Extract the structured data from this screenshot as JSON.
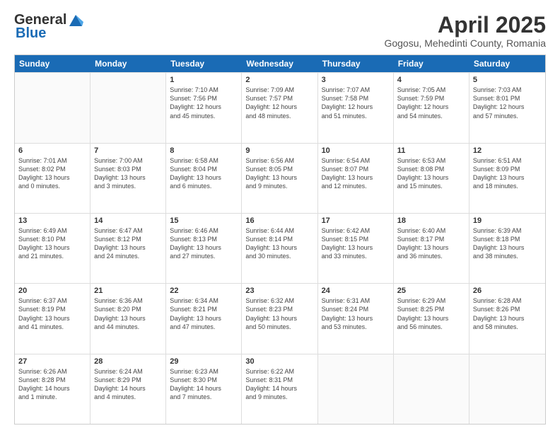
{
  "header": {
    "logo_general": "General",
    "logo_blue": "Blue",
    "month_title": "April 2025",
    "subtitle": "Gogosu, Mehedinti County, Romania"
  },
  "calendar": {
    "days": [
      "Sunday",
      "Monday",
      "Tuesday",
      "Wednesday",
      "Thursday",
      "Friday",
      "Saturday"
    ],
    "rows": [
      [
        {
          "day": "",
          "empty": true
        },
        {
          "day": "",
          "empty": true
        },
        {
          "day": "1",
          "line1": "Sunrise: 7:10 AM",
          "line2": "Sunset: 7:56 PM",
          "line3": "Daylight: 12 hours",
          "line4": "and 45 minutes."
        },
        {
          "day": "2",
          "line1": "Sunrise: 7:09 AM",
          "line2": "Sunset: 7:57 PM",
          "line3": "Daylight: 12 hours",
          "line4": "and 48 minutes."
        },
        {
          "day": "3",
          "line1": "Sunrise: 7:07 AM",
          "line2": "Sunset: 7:58 PM",
          "line3": "Daylight: 12 hours",
          "line4": "and 51 minutes."
        },
        {
          "day": "4",
          "line1": "Sunrise: 7:05 AM",
          "line2": "Sunset: 7:59 PM",
          "line3": "Daylight: 12 hours",
          "line4": "and 54 minutes."
        },
        {
          "day": "5",
          "line1": "Sunrise: 7:03 AM",
          "line2": "Sunset: 8:01 PM",
          "line3": "Daylight: 12 hours",
          "line4": "and 57 minutes."
        }
      ],
      [
        {
          "day": "6",
          "line1": "Sunrise: 7:01 AM",
          "line2": "Sunset: 8:02 PM",
          "line3": "Daylight: 13 hours",
          "line4": "and 0 minutes."
        },
        {
          "day": "7",
          "line1": "Sunrise: 7:00 AM",
          "line2": "Sunset: 8:03 PM",
          "line3": "Daylight: 13 hours",
          "line4": "and 3 minutes."
        },
        {
          "day": "8",
          "line1": "Sunrise: 6:58 AM",
          "line2": "Sunset: 8:04 PM",
          "line3": "Daylight: 13 hours",
          "line4": "and 6 minutes."
        },
        {
          "day": "9",
          "line1": "Sunrise: 6:56 AM",
          "line2": "Sunset: 8:05 PM",
          "line3": "Daylight: 13 hours",
          "line4": "and 9 minutes."
        },
        {
          "day": "10",
          "line1": "Sunrise: 6:54 AM",
          "line2": "Sunset: 8:07 PM",
          "line3": "Daylight: 13 hours",
          "line4": "and 12 minutes."
        },
        {
          "day": "11",
          "line1": "Sunrise: 6:53 AM",
          "line2": "Sunset: 8:08 PM",
          "line3": "Daylight: 13 hours",
          "line4": "and 15 minutes."
        },
        {
          "day": "12",
          "line1": "Sunrise: 6:51 AM",
          "line2": "Sunset: 8:09 PM",
          "line3": "Daylight: 13 hours",
          "line4": "and 18 minutes."
        }
      ],
      [
        {
          "day": "13",
          "line1": "Sunrise: 6:49 AM",
          "line2": "Sunset: 8:10 PM",
          "line3": "Daylight: 13 hours",
          "line4": "and 21 minutes."
        },
        {
          "day": "14",
          "line1": "Sunrise: 6:47 AM",
          "line2": "Sunset: 8:12 PM",
          "line3": "Daylight: 13 hours",
          "line4": "and 24 minutes."
        },
        {
          "day": "15",
          "line1": "Sunrise: 6:46 AM",
          "line2": "Sunset: 8:13 PM",
          "line3": "Daylight: 13 hours",
          "line4": "and 27 minutes."
        },
        {
          "day": "16",
          "line1": "Sunrise: 6:44 AM",
          "line2": "Sunset: 8:14 PM",
          "line3": "Daylight: 13 hours",
          "line4": "and 30 minutes."
        },
        {
          "day": "17",
          "line1": "Sunrise: 6:42 AM",
          "line2": "Sunset: 8:15 PM",
          "line3": "Daylight: 13 hours",
          "line4": "and 33 minutes."
        },
        {
          "day": "18",
          "line1": "Sunrise: 6:40 AM",
          "line2": "Sunset: 8:17 PM",
          "line3": "Daylight: 13 hours",
          "line4": "and 36 minutes."
        },
        {
          "day": "19",
          "line1": "Sunrise: 6:39 AM",
          "line2": "Sunset: 8:18 PM",
          "line3": "Daylight: 13 hours",
          "line4": "and 38 minutes."
        }
      ],
      [
        {
          "day": "20",
          "line1": "Sunrise: 6:37 AM",
          "line2": "Sunset: 8:19 PM",
          "line3": "Daylight: 13 hours",
          "line4": "and 41 minutes."
        },
        {
          "day": "21",
          "line1": "Sunrise: 6:36 AM",
          "line2": "Sunset: 8:20 PM",
          "line3": "Daylight: 13 hours",
          "line4": "and 44 minutes."
        },
        {
          "day": "22",
          "line1": "Sunrise: 6:34 AM",
          "line2": "Sunset: 8:21 PM",
          "line3": "Daylight: 13 hours",
          "line4": "and 47 minutes."
        },
        {
          "day": "23",
          "line1": "Sunrise: 6:32 AM",
          "line2": "Sunset: 8:23 PM",
          "line3": "Daylight: 13 hours",
          "line4": "and 50 minutes."
        },
        {
          "day": "24",
          "line1": "Sunrise: 6:31 AM",
          "line2": "Sunset: 8:24 PM",
          "line3": "Daylight: 13 hours",
          "line4": "and 53 minutes."
        },
        {
          "day": "25",
          "line1": "Sunrise: 6:29 AM",
          "line2": "Sunset: 8:25 PM",
          "line3": "Daylight: 13 hours",
          "line4": "and 56 minutes."
        },
        {
          "day": "26",
          "line1": "Sunrise: 6:28 AM",
          "line2": "Sunset: 8:26 PM",
          "line3": "Daylight: 13 hours",
          "line4": "and 58 minutes."
        }
      ],
      [
        {
          "day": "27",
          "line1": "Sunrise: 6:26 AM",
          "line2": "Sunset: 8:28 PM",
          "line3": "Daylight: 14 hours",
          "line4": "and 1 minute."
        },
        {
          "day": "28",
          "line1": "Sunrise: 6:24 AM",
          "line2": "Sunset: 8:29 PM",
          "line3": "Daylight: 14 hours",
          "line4": "and 4 minutes."
        },
        {
          "day": "29",
          "line1": "Sunrise: 6:23 AM",
          "line2": "Sunset: 8:30 PM",
          "line3": "Daylight: 14 hours",
          "line4": "and 7 minutes."
        },
        {
          "day": "30",
          "line1": "Sunrise: 6:22 AM",
          "line2": "Sunset: 8:31 PM",
          "line3": "Daylight: 14 hours",
          "line4": "and 9 minutes."
        },
        {
          "day": "",
          "empty": true
        },
        {
          "day": "",
          "empty": true
        },
        {
          "day": "",
          "empty": true
        }
      ]
    ]
  }
}
